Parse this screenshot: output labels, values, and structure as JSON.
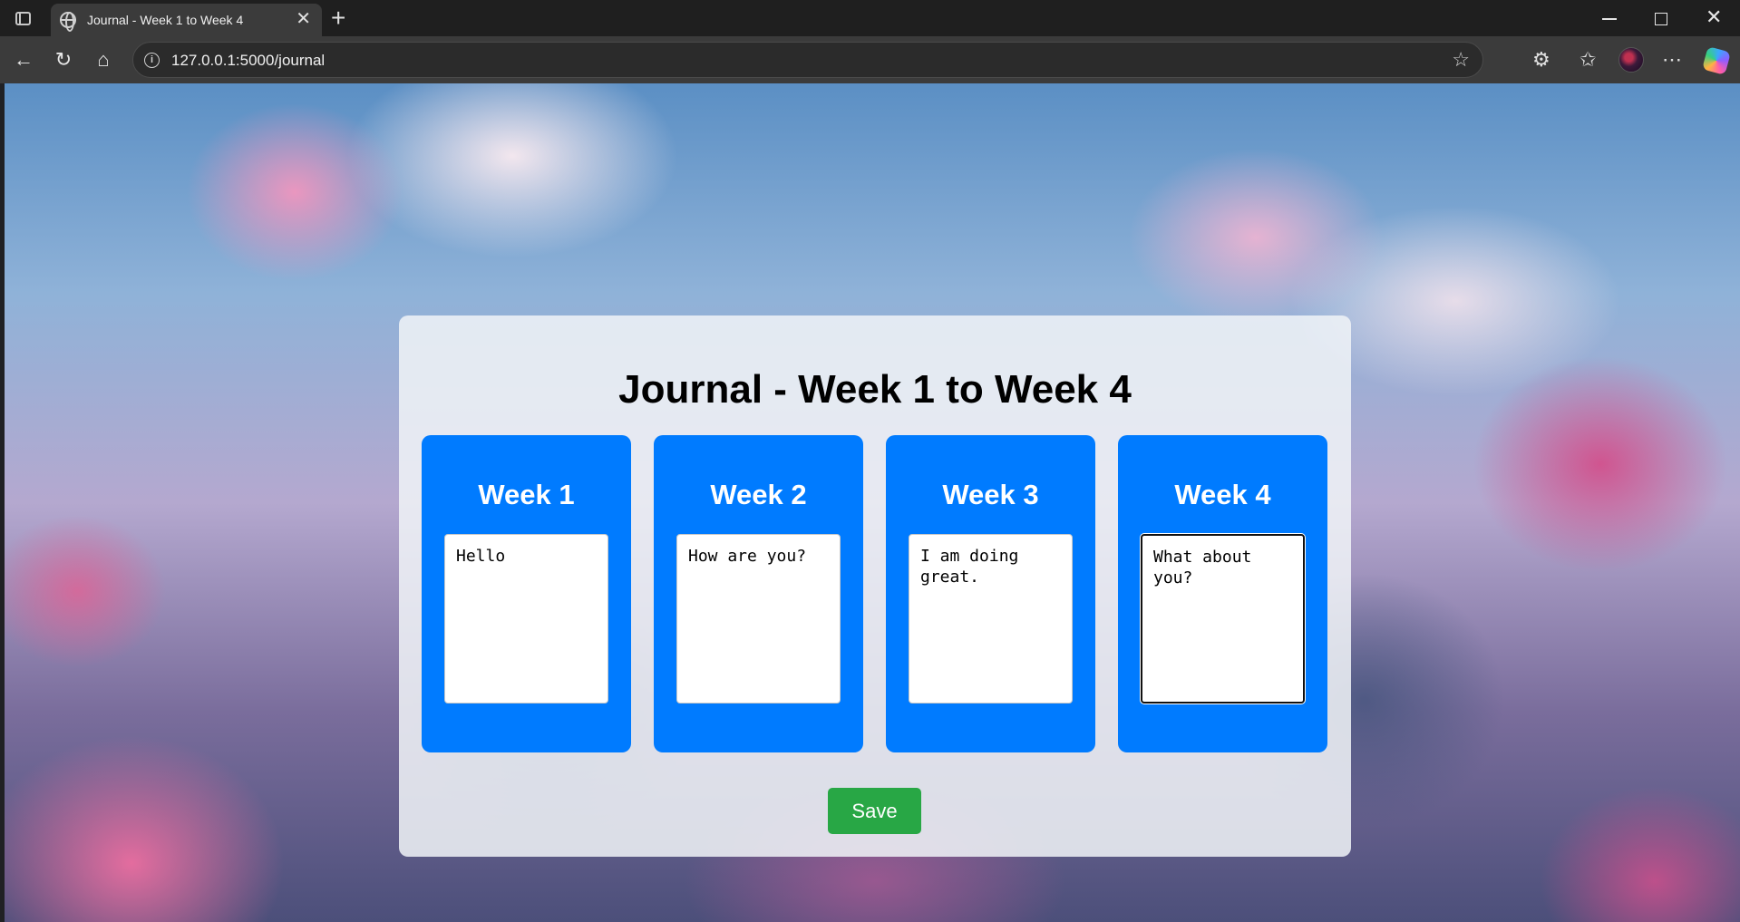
{
  "browser": {
    "tab_title": "Journal - Week 1 to Week 4",
    "url": "127.0.0.1:5000/journal",
    "tab_close": "✕",
    "new_tab": "+"
  },
  "page": {
    "heading": "Journal - Week 1 to Week 4",
    "weeks": [
      {
        "title": "Week 1",
        "entry": "Hello"
      },
      {
        "title": "Week 2",
        "entry": "How are you?"
      },
      {
        "title": "Week 3",
        "entry": "I am doing great."
      },
      {
        "title": "Week 4",
        "entry": "What about you?"
      }
    ],
    "save_label": "Save"
  },
  "colors": {
    "week_card": "#007bff",
    "save_button": "#28a745"
  },
  "icons": [
    "sidebar-toggle-icon",
    "globe-icon",
    "back-icon",
    "reload-icon",
    "home-icon",
    "info-icon",
    "favorite-star-icon",
    "extensions-icon",
    "favorites-icon",
    "more-icon",
    "copilot-icon"
  ]
}
